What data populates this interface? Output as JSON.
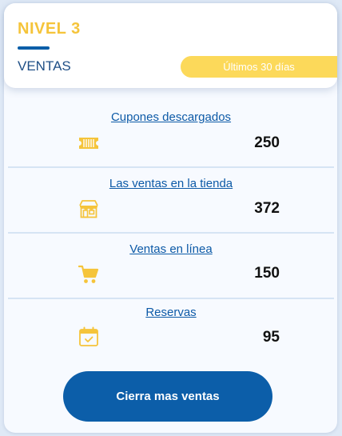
{
  "header": {
    "level_label": "NIVEL 3",
    "section_title": "VENTAS",
    "period_label": "Últimos 30 días"
  },
  "metrics": [
    {
      "label": "Cupones descargados",
      "value": "250",
      "icon": "ticket-icon"
    },
    {
      "label": "Las ventas en la tienda",
      "value": "372",
      "icon": "store-icon"
    },
    {
      "label": "Ventas en línea",
      "value": "150",
      "icon": "cart-icon"
    },
    {
      "label": "Reservas",
      "value": "95",
      "icon": "calendar-icon"
    }
  ],
  "cta": {
    "label": "Cierra mas ventas"
  },
  "colors": {
    "accent_yellow": "#f5c43a",
    "pill_yellow": "#fcd95a",
    "primary_blue": "#0c5ea9",
    "link_blue": "#0d5aa7"
  }
}
